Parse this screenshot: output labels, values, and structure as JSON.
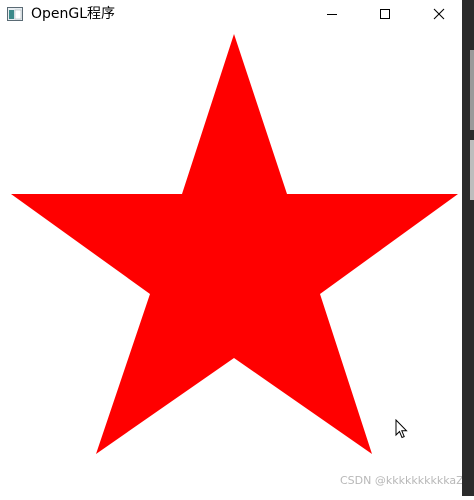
{
  "window": {
    "title": "OpenGL程序",
    "icon": "app-window-icon",
    "controls": {
      "minimize_icon": "minimize-icon",
      "maximize_icon": "maximize-icon",
      "close_icon": "close-icon"
    }
  },
  "canvas": {
    "background": "#ffffff",
    "shape": "five-pointed-star",
    "fill": "#ff0000"
  },
  "watermark": {
    "text": "CSDN @kkkkkkkkkkaZZL"
  },
  "cursor": {
    "icon": "mouse-pointer-icon"
  }
}
